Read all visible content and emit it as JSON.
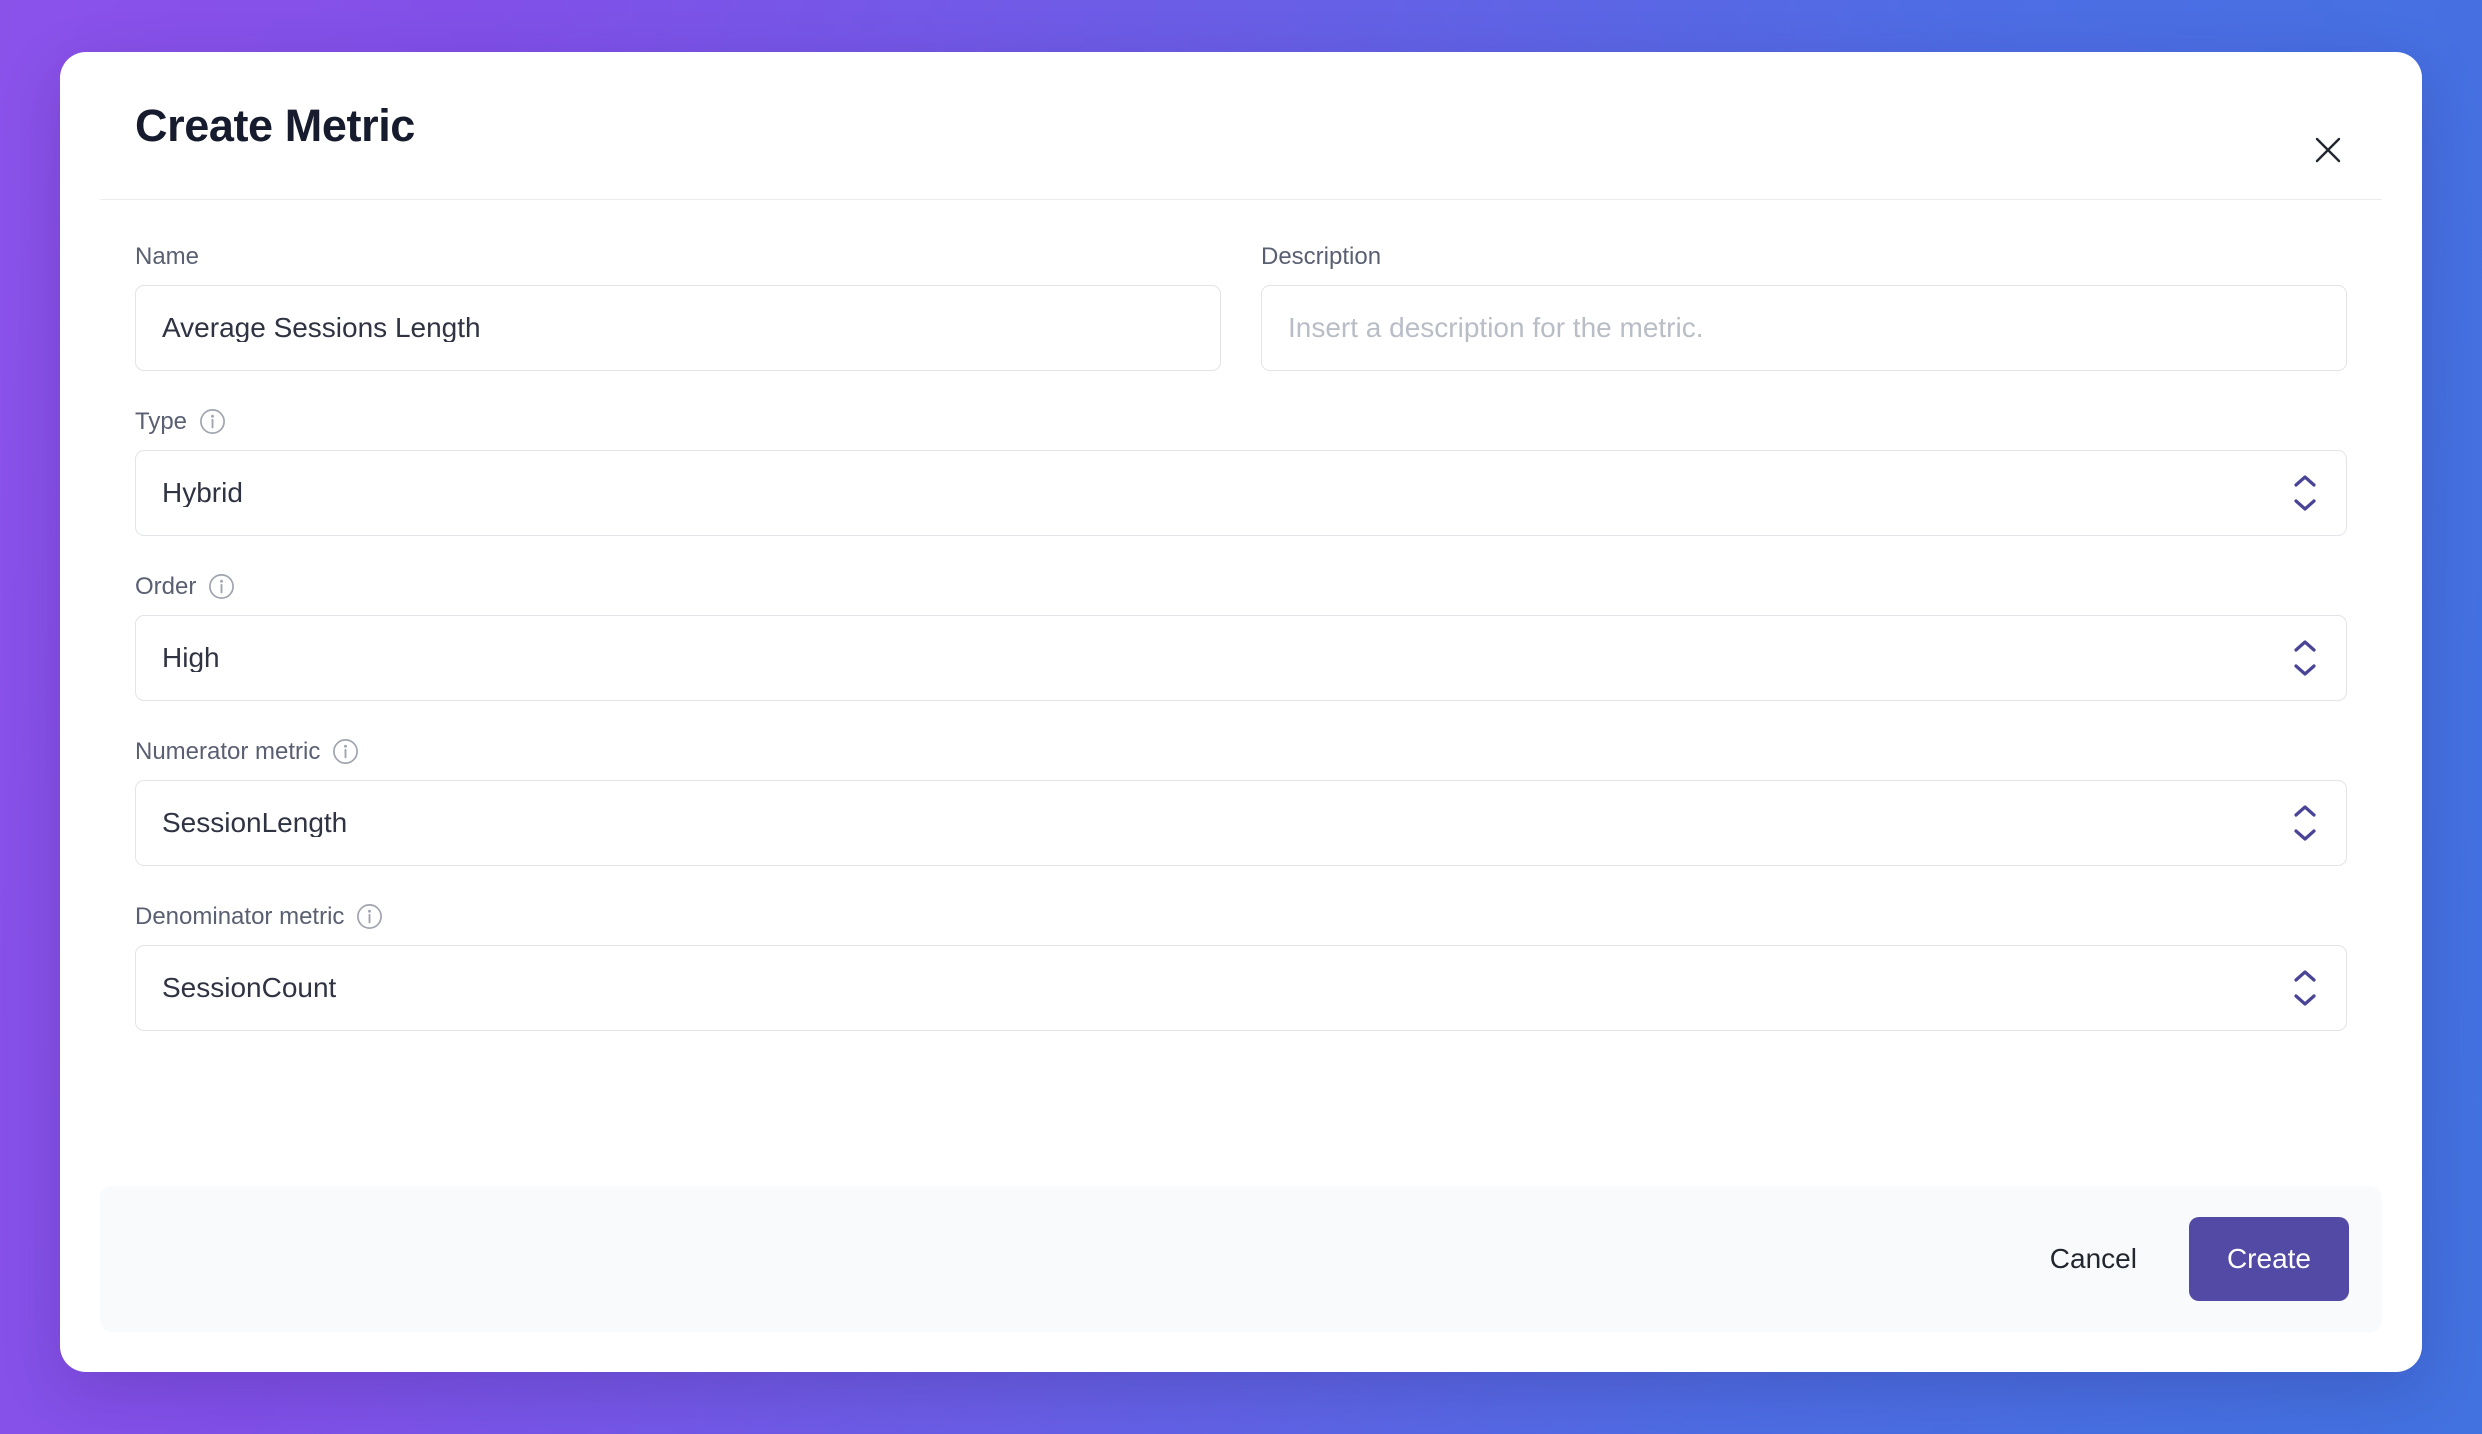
{
  "theme": {
    "background_gradient_start": "#8B52EA",
    "background_gradient_end": "#4272E0",
    "accent": "#524AA5",
    "chevron_color": "#4A4496",
    "card_background": "#FFFFFF",
    "footer_background": "#F9FAFC",
    "border_color": "#E2E4E9"
  },
  "dialog": {
    "title": "Create Metric",
    "close_icon": "close-icon"
  },
  "fields": {
    "name": {
      "label": "Name",
      "value": "Average Sessions Length",
      "placeholder": ""
    },
    "description": {
      "label": "Description",
      "value": "",
      "placeholder": "Insert a description for the metric."
    },
    "type": {
      "label": "Type",
      "value": "Hybrid",
      "info_icon": "info-icon"
    },
    "order": {
      "label": "Order",
      "value": "High",
      "info_icon": "info-icon"
    },
    "numerator": {
      "label": "Numerator metric",
      "value": "SessionLength",
      "info_icon": "info-icon"
    },
    "denominator": {
      "label": "Denominator metric",
      "value": "SessionCount",
      "info_icon": "info-icon"
    }
  },
  "footer": {
    "cancel_label": "Cancel",
    "create_label": "Create"
  }
}
